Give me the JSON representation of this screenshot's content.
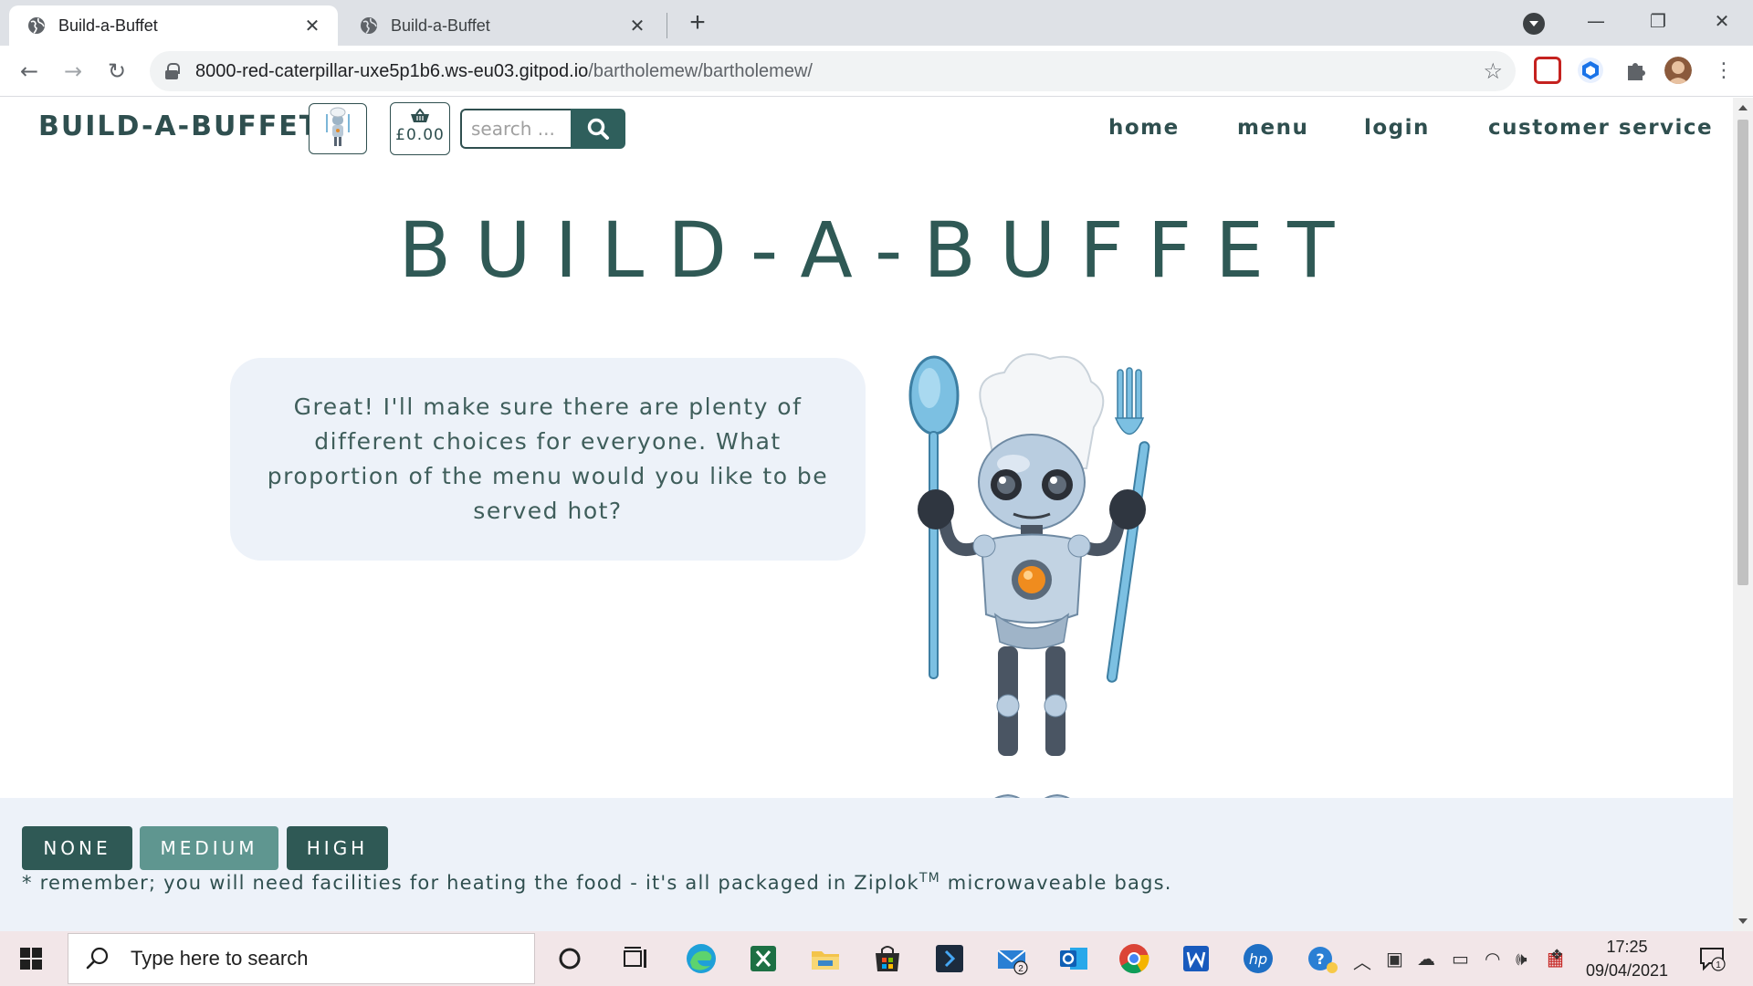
{
  "browser": {
    "tabs": [
      {
        "title": "Build-a-Buffet",
        "close": "✕"
      },
      {
        "title": "Build-a-Buffet",
        "close": "✕"
      }
    ],
    "new_tab": "+",
    "url_host": "8000-red-caterpillar-uxe5p1b6.ws-eu03.gitpod.io",
    "url_path": "/bartholemew/bartholemew/",
    "window_controls": {
      "minimize": "—",
      "restore": "❐",
      "close": "✕"
    },
    "nav_icons": {
      "back": "←",
      "forward": "→",
      "reload": "↻",
      "star": "☆"
    }
  },
  "site": {
    "brand": "BUILD-A-BUFFET",
    "basket_amount": "£0.00",
    "search_placeholder": "search ...",
    "nav": [
      "home",
      "menu",
      "login",
      "customer service"
    ],
    "hero_title": "BUILD-A-BUFFET",
    "bubble_text": "Great! I'll make sure there are plenty of different choices for everyone. What proportion of the menu would you like to be served hot?",
    "options": [
      "NONE",
      "MEDIUM",
      "HIGH"
    ],
    "note_prefix": "* remember; you will need facilities for heating the food - it's all packaged in Ziplok",
    "note_sup": "TM",
    "note_suffix": " microwaveable bags.",
    "colors": {
      "primary": "#2f5955",
      "primary_light": "#5f9690",
      "panel": "#edf2f9"
    }
  },
  "taskbar": {
    "search_placeholder": "Type here to search",
    "time": "17:25",
    "date": "09/04/2021",
    "mail_badge": "2",
    "notif_badge": "1",
    "apps": [
      "cortana-icon",
      "task-view-icon",
      "edge-icon",
      "excel-icon",
      "file-explorer-icon",
      "store-icon",
      "visual-studio-icon",
      "mail-icon",
      "outlook-icon",
      "chrome-icon",
      "word-icon",
      "hp-icon"
    ]
  }
}
